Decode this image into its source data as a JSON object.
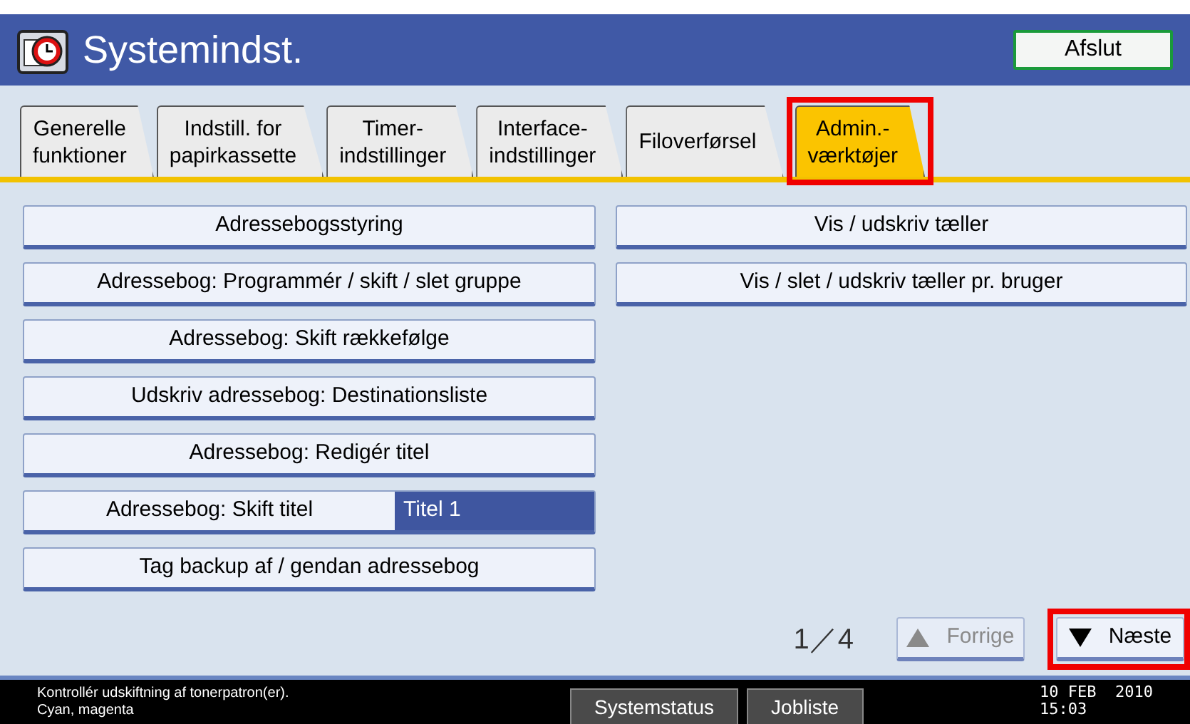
{
  "header": {
    "title": "Systemindst.",
    "exit_button": "Afslut"
  },
  "tabs": [
    {
      "label": "Generelle\nfunktioner",
      "selected": false,
      "highlighted": false
    },
    {
      "label": "Indstill. for\npapirkassette",
      "selected": false,
      "highlighted": false
    },
    {
      "label": "Timer-\nindstillinger",
      "selected": false,
      "highlighted": false
    },
    {
      "label": "Interface-\nindstillinger",
      "selected": false,
      "highlighted": false
    },
    {
      "label": "Filoverførsel",
      "selected": false,
      "highlighted": false
    },
    {
      "label": "Admin.-\nværktøjer",
      "selected": true,
      "highlighted": true
    }
  ],
  "left_buttons": [
    {
      "label": "Adressebogsstyring"
    },
    {
      "label": "Adressebog: Programmér / skift / slet gruppe"
    },
    {
      "label": "Adressebog: Skift rækkefølge"
    },
    {
      "label": "Udskriv adressebog: Destinationsliste"
    },
    {
      "label": "Adressebog: Redigér titel"
    },
    {
      "label": "Adressebog: Skift titel",
      "value": "Titel 1"
    },
    {
      "label": "Tag backup af / gendan adressebog"
    }
  ],
  "right_buttons": [
    {
      "label": "Vis / udskriv tæller"
    },
    {
      "label": "Vis / slet / udskriv tæller pr. bruger"
    }
  ],
  "pager": {
    "page": "1／4",
    "previous": {
      "label": "Forrige",
      "disabled": true,
      "highlighted": false
    },
    "next": {
      "label": "Næste",
      "disabled": false,
      "highlighted": true
    }
  },
  "status_bar": {
    "message": [
      "Kontrollér udskiftning af tonerpatron(er).",
      "Cyan, magenta"
    ],
    "buttons": [
      "Systemstatus",
      "Jobliste"
    ],
    "date": "10 FEB  2010",
    "time": "15:03"
  }
}
